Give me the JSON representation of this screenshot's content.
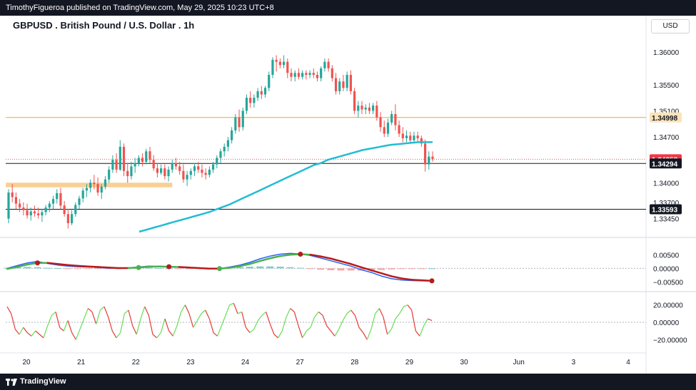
{
  "header": {
    "publisher_line": "TimothyFigueroa published on TradingView.com, May 29, 2025 10:23 UTC+8",
    "chart_title": "GBPUSD . British Pound / U.S. Dollar . 1h",
    "currency": "USD"
  },
  "footer": {
    "brand": "TradingView"
  },
  "colors": {
    "up": "#26a69a",
    "down": "#ef5350",
    "ema": "#22bcd4",
    "orange_line": "#f5a623",
    "zone": "#f9c784",
    "macd_fast": "#2962ff",
    "macd_slow_up": "#4caf50",
    "macd_slow_down": "#b71c1c"
  },
  "chart_data": [
    {
      "type": "candlestick",
      "series": [
        {
          "name": "GBPUSD 1h"
        }
      ],
      "x_ticks": [
        "20",
        "21",
        "22",
        "23",
        "24",
        "27",
        "28",
        "29",
        "30",
        "Jun",
        "3",
        "4"
      ],
      "y_ticks": [
        "1.36000",
        "1.35500",
        "1.35100",
        "1.34700",
        "1.34000",
        "1.33700",
        "1.33450"
      ],
      "ylim": [
        1.3325,
        1.3625
      ],
      "price_labels": [
        {
          "label": "1.34998",
          "value": 1.34998,
          "style": "orange-line"
        },
        {
          "label": "1.34358",
          "value": 1.34358,
          "style": "last-price"
        },
        {
          "label": "1.34294",
          "value": 1.34294,
          "style": "black-line"
        },
        {
          "label": "1.33593",
          "value": 1.33593,
          "style": "black-line"
        }
      ],
      "zone": {
        "from_value": 1.3393,
        "to_value": 1.34,
        "x_from_index": 0,
        "x_to_index": 44
      },
      "ohlc": [
        [
          1.3345,
          1.339,
          1.3338,
          1.3385
        ],
        [
          1.3385,
          1.3398,
          1.337,
          1.3378
        ],
        [
          1.3378,
          1.3385,
          1.336,
          1.3368
        ],
        [
          1.3368,
          1.3375,
          1.3355,
          1.3362
        ],
        [
          1.3362,
          1.337,
          1.335,
          1.3358
        ],
        [
          1.3358,
          1.3368,
          1.3345,
          1.335
        ],
        [
          1.335,
          1.3362,
          1.3342,
          1.3356
        ],
        [
          1.3356,
          1.3365,
          1.3348,
          1.3353
        ],
        [
          1.3353,
          1.3362,
          1.3345,
          1.335
        ],
        [
          1.335,
          1.336,
          1.334,
          1.3355
        ],
        [
          1.3355,
          1.3366,
          1.335,
          1.3362
        ],
        [
          1.3362,
          1.3372,
          1.3355,
          1.3368
        ],
        [
          1.3368,
          1.338,
          1.336,
          1.3375
        ],
        [
          1.3375,
          1.339,
          1.3368,
          1.3384
        ],
        [
          1.3384,
          1.3392,
          1.336,
          1.3365
        ],
        [
          1.3365,
          1.3372,
          1.3348,
          1.3352
        ],
        [
          1.3352,
          1.336,
          1.333,
          1.3338
        ],
        [
          1.3338,
          1.3358,
          1.3335,
          1.3352
        ],
        [
          1.3352,
          1.337,
          1.3348,
          1.3366
        ],
        [
          1.3366,
          1.338,
          1.336,
          1.3376
        ],
        [
          1.3376,
          1.3392,
          1.337,
          1.3388
        ],
        [
          1.3388,
          1.3398,
          1.3378,
          1.3392
        ],
        [
          1.3392,
          1.3405,
          1.3385,
          1.34
        ],
        [
          1.34,
          1.3412,
          1.339,
          1.3398
        ],
        [
          1.3398,
          1.3408,
          1.338,
          1.3385
        ],
        [
          1.3385,
          1.3398,
          1.3375,
          1.3394
        ],
        [
          1.3394,
          1.341,
          1.339,
          1.3405
        ],
        [
          1.3405,
          1.3425,
          1.34,
          1.342
        ],
        [
          1.342,
          1.3442,
          1.3415,
          1.3435
        ],
        [
          1.3435,
          1.3445,
          1.3415,
          1.342
        ],
        [
          1.342,
          1.3465,
          1.3418,
          1.3455
        ],
        [
          1.3455,
          1.346,
          1.341,
          1.3418
        ],
        [
          1.3418,
          1.343,
          1.34,
          1.341
        ],
        [
          1.341,
          1.3432,
          1.3405,
          1.3425
        ],
        [
          1.3425,
          1.3438,
          1.3415,
          1.343
        ],
        [
          1.343,
          1.3442,
          1.3425,
          1.3438
        ],
        [
          1.3438,
          1.3445,
          1.3425,
          1.3432
        ],
        [
          1.3432,
          1.3452,
          1.3428,
          1.3448
        ],
        [
          1.3448,
          1.3455,
          1.343,
          1.3435
        ],
        [
          1.3435,
          1.3442,
          1.3418,
          1.3422
        ],
        [
          1.3422,
          1.343,
          1.3408,
          1.3415
        ],
        [
          1.3415,
          1.3428,
          1.3412,
          1.3422
        ],
        [
          1.3422,
          1.3428,
          1.3405,
          1.341
        ],
        [
          1.341,
          1.3425,
          1.3402,
          1.342
        ],
        [
          1.342,
          1.3435,
          1.3415,
          1.343
        ],
        [
          1.343,
          1.3438,
          1.342,
          1.3425
        ],
        [
          1.3425,
          1.3432,
          1.3412,
          1.3418
        ],
        [
          1.3418,
          1.3428,
          1.34,
          1.3405
        ],
        [
          1.3405,
          1.3418,
          1.3395,
          1.3412
        ],
        [
          1.3412,
          1.3422,
          1.3405,
          1.3418
        ],
        [
          1.3418,
          1.343,
          1.341,
          1.3425
        ],
        [
          1.3425,
          1.3432,
          1.3415,
          1.342
        ],
        [
          1.342,
          1.3428,
          1.3408,
          1.3415
        ],
        [
          1.3415,
          1.3422,
          1.3405,
          1.3412
        ],
        [
          1.3412,
          1.3425,
          1.3408,
          1.342
        ],
        [
          1.342,
          1.3432,
          1.3415,
          1.3428
        ],
        [
          1.3428,
          1.3442,
          1.3422,
          1.3438
        ],
        [
          1.3438,
          1.3452,
          1.343,
          1.3448
        ],
        [
          1.3448,
          1.346,
          1.344,
          1.3455
        ],
        [
          1.3455,
          1.347,
          1.3448,
          1.3465
        ],
        [
          1.3465,
          1.3485,
          1.346,
          1.348
        ],
        [
          1.348,
          1.3505,
          1.3475,
          1.35
        ],
        [
          1.35,
          1.3512,
          1.3478,
          1.3485
        ],
        [
          1.3485,
          1.3515,
          1.348,
          1.351
        ],
        [
          1.351,
          1.3535,
          1.3505,
          1.353
        ],
        [
          1.353,
          1.354,
          1.3515,
          1.3522
        ],
        [
          1.3522,
          1.3535,
          1.3515,
          1.353
        ],
        [
          1.353,
          1.3545,
          1.3525,
          1.354
        ],
        [
          1.354,
          1.3548,
          1.3528,
          1.3535
        ],
        [
          1.3535,
          1.3548,
          1.353,
          1.3545
        ],
        [
          1.3545,
          1.357,
          1.354,
          1.3565
        ],
        [
          1.3565,
          1.3592,
          1.356,
          1.3588
        ],
        [
          1.3588,
          1.3595,
          1.357,
          1.3585
        ],
        [
          1.3585,
          1.359,
          1.3575,
          1.358
        ],
        [
          1.358,
          1.3595,
          1.3575,
          1.3585
        ],
        [
          1.3585,
          1.359,
          1.356,
          1.3568
        ],
        [
          1.3568,
          1.3575,
          1.3555,
          1.3562
        ],
        [
          1.3562,
          1.3572,
          1.3555,
          1.3568
        ],
        [
          1.3568,
          1.3575,
          1.3558,
          1.3562
        ],
        [
          1.3562,
          1.3572,
          1.3558,
          1.3568
        ],
        [
          1.3568,
          1.3572,
          1.3558,
          1.3565
        ],
        [
          1.3565,
          1.3572,
          1.356,
          1.3568
        ],
        [
          1.3568,
          1.3575,
          1.356,
          1.3565
        ],
        [
          1.3565,
          1.357,
          1.3555,
          1.356
        ],
        [
          1.356,
          1.3578,
          1.3555,
          1.3575
        ],
        [
          1.3575,
          1.359,
          1.357,
          1.3585
        ],
        [
          1.3585,
          1.359,
          1.357,
          1.3575
        ],
        [
          1.3575,
          1.358,
          1.3555,
          1.356
        ],
        [
          1.356,
          1.3568,
          1.3535,
          1.354
        ],
        [
          1.354,
          1.356,
          1.3535,
          1.3555
        ],
        [
          1.3555,
          1.3565,
          1.354,
          1.3545
        ],
        [
          1.3545,
          1.357,
          1.354,
          1.3565
        ],
        [
          1.3565,
          1.3572,
          1.3535,
          1.354
        ],
        [
          1.354,
          1.3545,
          1.3505,
          1.351
        ],
        [
          1.351,
          1.3525,
          1.35,
          1.3518
        ],
        [
          1.3518,
          1.3525,
          1.3505,
          1.3512
        ],
        [
          1.3512,
          1.352,
          1.3505,
          1.3515
        ],
        [
          1.3515,
          1.3522,
          1.3505,
          1.351
        ],
        [
          1.351,
          1.3522,
          1.3505,
          1.3518
        ],
        [
          1.3518,
          1.3525,
          1.3495,
          1.35
        ],
        [
          1.35,
          1.3508,
          1.3478,
          1.3485
        ],
        [
          1.3485,
          1.3495,
          1.347,
          1.3475
        ],
        [
          1.3475,
          1.3498,
          1.347,
          1.3492
        ],
        [
          1.3492,
          1.351,
          1.3488,
          1.3505
        ],
        [
          1.3505,
          1.352,
          1.348,
          1.3488
        ],
        [
          1.3488,
          1.3495,
          1.347,
          1.3475
        ],
        [
          1.3475,
          1.3485,
          1.3462,
          1.3468
        ],
        [
          1.3468,
          1.348,
          1.3462,
          1.3472
        ],
        [
          1.3472,
          1.3478,
          1.346,
          1.3465
        ],
        [
          1.3465,
          1.3478,
          1.346,
          1.3472
        ],
        [
          1.3472,
          1.3478,
          1.3462,
          1.3468
        ],
        [
          1.3468,
          1.3472,
          1.3455,
          1.346
        ],
        [
          1.346,
          1.3466,
          1.3417,
          1.3428
        ],
        [
          1.3428,
          1.3448,
          1.342,
          1.344
        ],
        [
          1.344,
          1.3448,
          1.3432,
          1.3436
        ]
      ],
      "ema_values": [
        1.3325,
        1.3328,
        1.3331,
        1.3334,
        1.3337,
        1.334,
        1.3343,
        1.3346,
        1.3349,
        1.3352,
        1.3355,
        1.3359,
        1.3363,
        1.3367,
        1.3372,
        1.3377,
        1.3382,
        1.3387,
        1.3392,
        1.3397,
        1.3402,
        1.3407,
        1.3412,
        1.3417,
        1.3422,
        1.3427,
        1.343,
        1.3435,
        1.3438,
        1.3441,
        1.3444,
        1.3447,
        1.345,
        1.3452,
        1.3454,
        1.3456,
        1.3458,
        1.3459,
        1.346,
        1.3461,
        1.3462,
        1.3462,
        1.3462
      ]
    },
    {
      "type": "line",
      "name": "MACD panel",
      "y_ticks": [
        "0.00500",
        "0.00000",
        "-0.00500"
      ],
      "ylim": [
        -0.0075,
        0.009
      ],
      "series": [
        {
          "name": "fast",
          "values": [
            0.0,
            0.001,
            0.002,
            0.0025,
            0.0018,
            0.0012,
            0.0008,
            0.0006,
            0.0005,
            0.0003,
            0.0001,
            0.0,
            0.0002,
            0.0005,
            0.0008,
            0.0007,
            0.0006,
            0.0004,
            0.0002,
            0.0,
            -0.0002,
            -0.0001,
            0.0005,
            0.0012,
            0.0022,
            0.0035,
            0.0045,
            0.0052,
            0.0055,
            0.0053,
            0.0047,
            0.0038,
            0.0028,
            0.0018,
            0.0008,
            -0.0005,
            -0.0015,
            -0.0028,
            -0.0038,
            -0.0043,
            -0.0045,
            -0.0046,
            -0.0047
          ]
        },
        {
          "name": "signal",
          "values": [
            -0.0002,
            0.0005,
            0.0014,
            0.002,
            0.002,
            0.0016,
            0.0012,
            0.0009,
            0.0007,
            0.0005,
            0.0003,
            0.0001,
            0.0001,
            0.0003,
            0.0006,
            0.0007,
            0.0006,
            0.0005,
            0.0003,
            0.0001,
            -0.0001,
            -0.0001,
            0.0002,
            0.0008,
            0.0016,
            0.0027,
            0.0037,
            0.0045,
            0.005,
            0.0052,
            0.005,
            0.0044,
            0.0036,
            0.0026,
            0.0016,
            0.0004,
            -0.0007,
            -0.0018,
            -0.0029,
            -0.0037,
            -0.0042,
            -0.0044,
            -0.0046
          ]
        }
      ],
      "histogram": [
        0.0002,
        0.0004,
        0.0005,
        0.0004,
        0.0002,
        0.0001,
        -0.0001,
        -0.0002,
        -0.0002,
        -0.0002,
        -0.0001,
        0.0,
        0.0001,
        0.0002,
        0.0002,
        0.0001,
        0.0,
        -0.0001,
        -0.0002,
        -0.0002,
        -0.0001,
        0.0001,
        0.0003,
        0.0005,
        0.0006,
        0.0007,
        0.0007,
        0.0006,
        0.0004,
        0.0002,
        -0.0002,
        -0.0005,
        -0.0007,
        -0.0008,
        -0.0008,
        -0.0008,
        -0.0007,
        -0.0006,
        -0.0004,
        -0.0002,
        -0.0001,
        -0.0001,
        0.0
      ],
      "cross_markers": [
        {
          "index": 3,
          "color": "down"
        },
        {
          "index": 13,
          "color": "up"
        },
        {
          "index": 16,
          "color": "down"
        },
        {
          "index": 21,
          "color": "up"
        },
        {
          "index": 29,
          "color": "down"
        },
        {
          "index": 42,
          "color": "up"
        },
        {
          "index": 43,
          "color": "down"
        }
      ]
    },
    {
      "type": "line",
      "name": "Oscillator panel",
      "y_ticks": [
        "20.00000",
        "0.00000",
        "-20.00000"
      ],
      "ylim": [
        -28,
        28
      ],
      "zero_line": 0,
      "values": [
        18,
        10,
        -8,
        -14,
        -6,
        -12,
        -16,
        -10,
        -14,
        -18,
        -4,
        8,
        12,
        -6,
        -10,
        2,
        -12,
        -20,
        -8,
        4,
        16,
        12,
        -2,
        14,
        18,
        6,
        -10,
        -18,
        -12,
        10,
        14,
        -4,
        -14,
        4,
        18,
        8,
        -14,
        -18,
        -12,
        4,
        -10,
        -16,
        -4,
        12,
        20,
        10,
        -6,
        2,
        10,
        14,
        4,
        -12,
        -16,
        -4,
        8,
        20,
        22,
        10,
        12,
        -6,
        -12,
        -8,
        2,
        8,
        12,
        -2,
        -14,
        -18,
        -10,
        6,
        16,
        12,
        -4,
        -18,
        -10,
        -6,
        6,
        12,
        8,
        -4,
        -10,
        -16,
        -8,
        2,
        10,
        14,
        8,
        -6,
        -12,
        -20,
        -8,
        10,
        16,
        6,
        -14,
        -8,
        4,
        10,
        18,
        20,
        14,
        -10,
        -16,
        -4,
        4,
        2
      ]
    }
  ]
}
